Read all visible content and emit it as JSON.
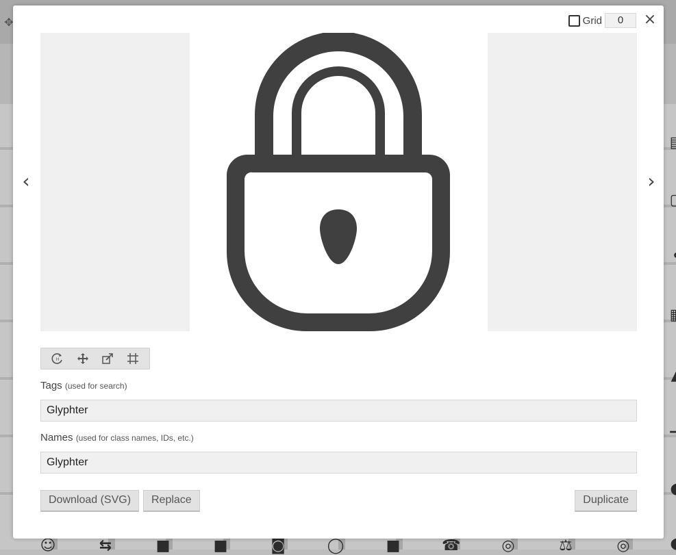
{
  "modal": {
    "grid_label": "Grid",
    "grid_value": "0",
    "close_symbol": "×",
    "prev_symbol": "‹",
    "next_symbol": "›",
    "glyph_icon": "lock-icon",
    "tools": [
      "rotate-icon",
      "move-icon",
      "resize-icon",
      "crop-grid-icon"
    ],
    "tags": {
      "label": "Tags",
      "hint": "(used for search)",
      "value": "Glyphter"
    },
    "names": {
      "label": "Names",
      "hint": "(used for class names, IDs, etc.)",
      "value": "Glyphter"
    },
    "buttons": {
      "download": "Download (SVG)",
      "replace": "Replace",
      "duplicate": "Duplicate"
    }
  },
  "colors": {
    "glyph": "#404040",
    "preview_bg": "#f0f0f0",
    "overlay": "#bdbdbd"
  }
}
